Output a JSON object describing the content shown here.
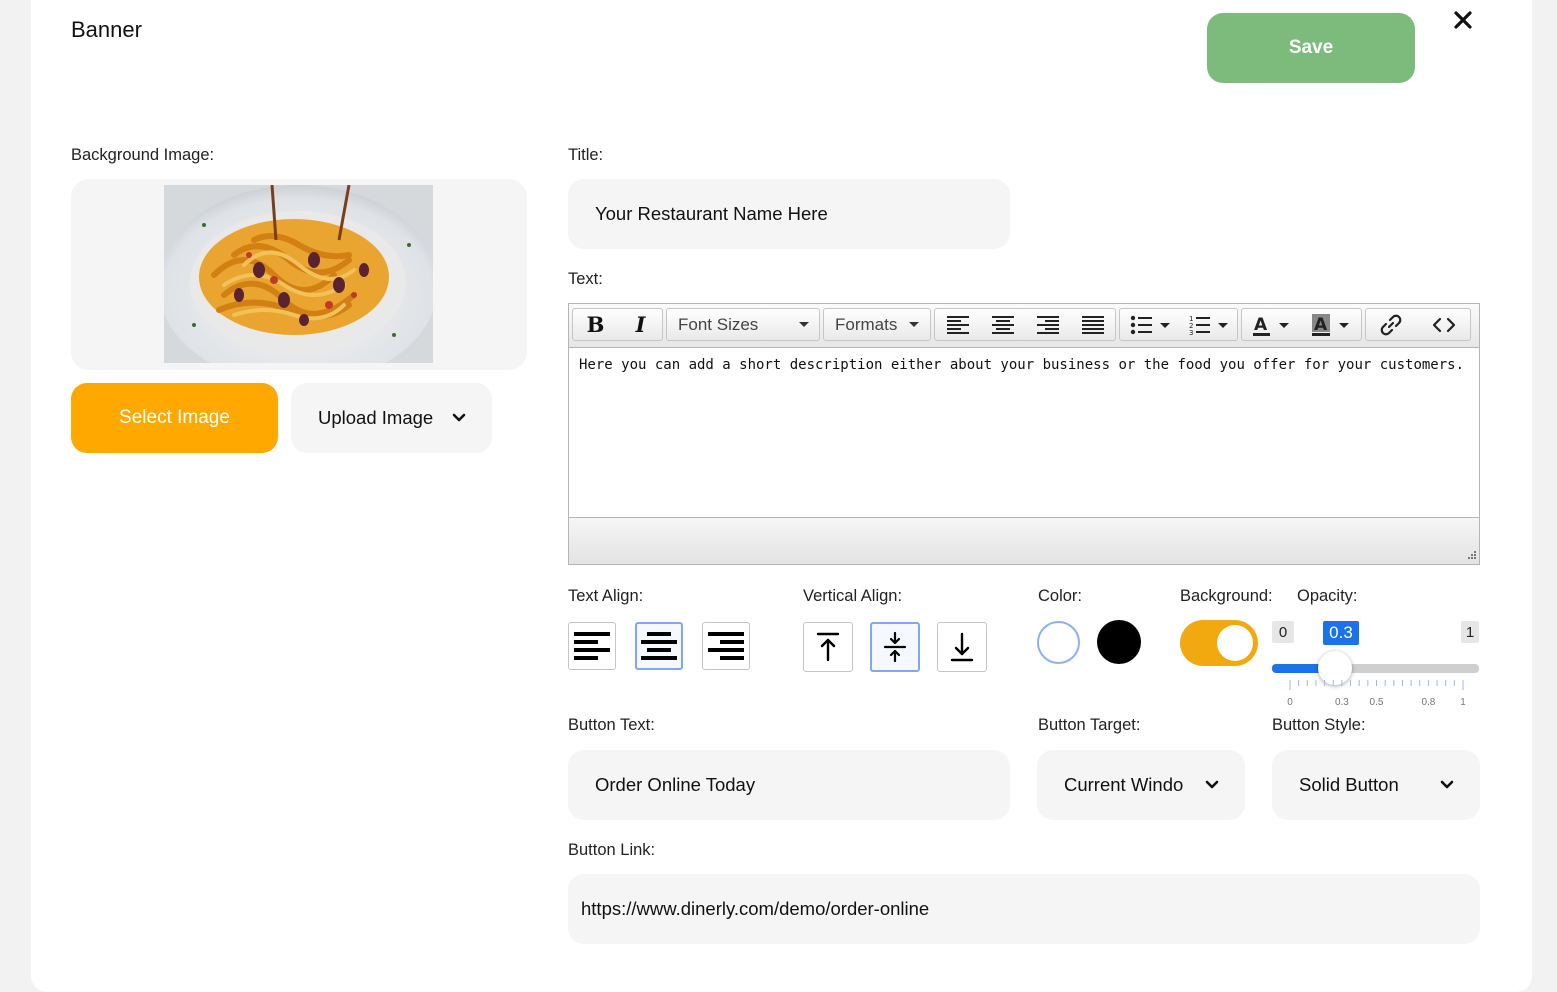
{
  "header": {
    "title": "Banner",
    "save_label": "Save"
  },
  "icons": {
    "close": "close-icon",
    "chevron": "chevron-down-icon"
  },
  "colors": {
    "save": "#7dbb7d",
    "select_image": "#ffa800",
    "toggle": "#f1a90f",
    "slider": "#1a73e8"
  },
  "background_image": {
    "label": "Background Image:",
    "select_label": "Select Image",
    "upload_label": "Upload Image"
  },
  "title_field": {
    "label": "Title:",
    "value": "Your Restaurant Name Here"
  },
  "text_field": {
    "label": "Text:",
    "content": "Here you can add a short description either about your business or the food you offer for your customers.",
    "toolbar": {
      "bold": "B",
      "italic": "I",
      "font_sizes": "Font Sizes",
      "formats": "Formats"
    }
  },
  "text_align": {
    "label": "Text Align:",
    "selected": "center"
  },
  "vertical_align": {
    "label": "Vertical Align:",
    "selected": "middle"
  },
  "color": {
    "label": "Color:",
    "options": [
      "white",
      "black"
    ],
    "selected": "white"
  },
  "background": {
    "label": "Background:",
    "enabled": true
  },
  "opacity": {
    "label": "Opacity:",
    "min_label": "0",
    "max_label": "1",
    "value_label": "0.3",
    "value": 0.3,
    "ticks": [
      "0",
      "0.3",
      "0.5",
      "0.8",
      "1"
    ]
  },
  "button_text": {
    "label": "Button Text:",
    "value": "Order Online Today"
  },
  "button_target": {
    "label": "Button Target:",
    "value": "Current Windo"
  },
  "button_style": {
    "label": "Button Style:",
    "value": "Solid Button"
  },
  "button_link": {
    "label": "Button Link:",
    "value": "https://www.dinerly.com/demo/order-online"
  }
}
